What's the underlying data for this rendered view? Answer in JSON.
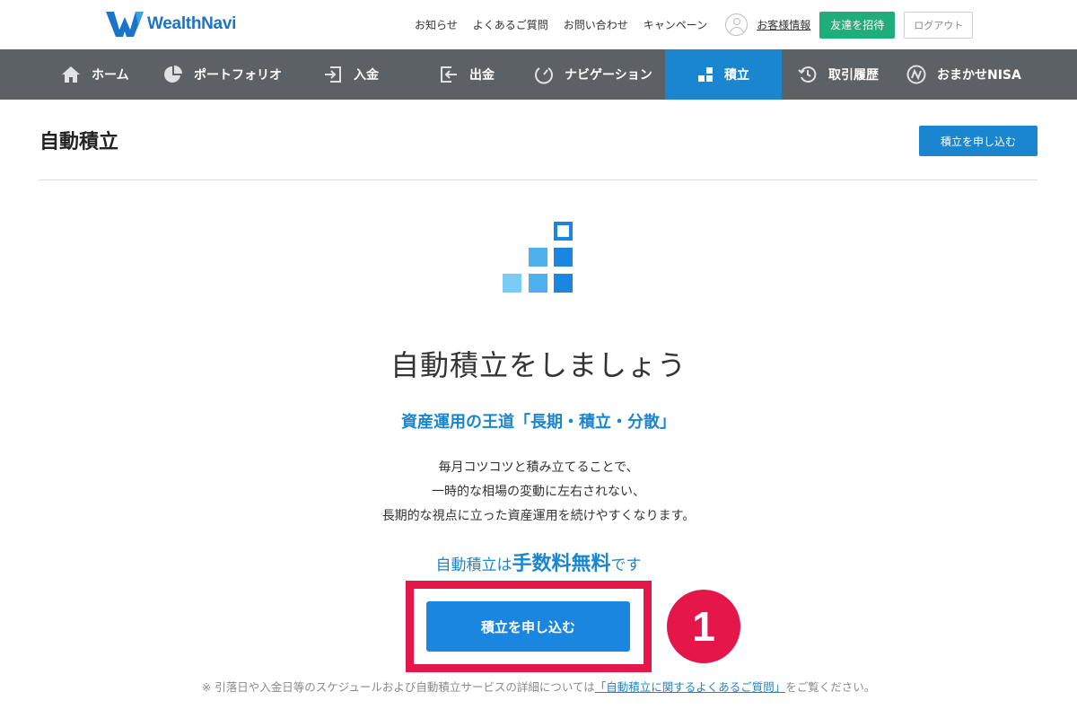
{
  "brand": {
    "name": "WealthNavi"
  },
  "header": {
    "links": [
      "お知らせ",
      "よくあるご質問",
      "お問い合わせ",
      "キャンペーン"
    ],
    "account_label": "お客様情報",
    "invite_label": "友達を招待",
    "logout_label": "ログアウト"
  },
  "nav": {
    "items": [
      {
        "label": "ホーム",
        "icon": "home-icon"
      },
      {
        "label": "ポートフォリオ",
        "icon": "pie-chart-icon"
      },
      {
        "label": "入金",
        "icon": "deposit-icon"
      },
      {
        "label": "出金",
        "icon": "withdraw-icon"
      },
      {
        "label": "ナビゲーション",
        "icon": "gauge-icon"
      },
      {
        "label": "積立",
        "icon": "stairs-blocks-icon"
      },
      {
        "label": "取引履歴",
        "icon": "history-icon"
      },
      {
        "label": "おまかせNISA",
        "icon": "nisa-logo-icon"
      }
    ],
    "active": "積立"
  },
  "page": {
    "title": "自動積立",
    "apply_small_label": "積立を申し込む",
    "headline": "自動積立をしましょう",
    "subhead": "資産運用の王道「長期・積立・分散」",
    "body_lines": [
      "毎月コツコツと積み立てることで、",
      "一時的な相場の変動に左右されない、",
      "長期的な視点に立った資産運用を続けやすくなります。"
    ],
    "fee_prefix": "自動積立は",
    "fee_strong": "手数料無料",
    "fee_suffix": "です",
    "apply_big_label": "積立を申し込む",
    "step_number": "1",
    "footnote_prefix": "※ 引落日や入金日等のスケジュールおよび自動積立サービスの詳細については",
    "footnote_link": "「自動積立に関するよくあるご質問」",
    "footnote_suffix": "をご覧ください。"
  },
  "colors": {
    "brand_blue": "#1a86cf",
    "nav_bg": "#5c6166",
    "invite_green": "#1fae7b",
    "highlight_red": "#e5174a"
  }
}
